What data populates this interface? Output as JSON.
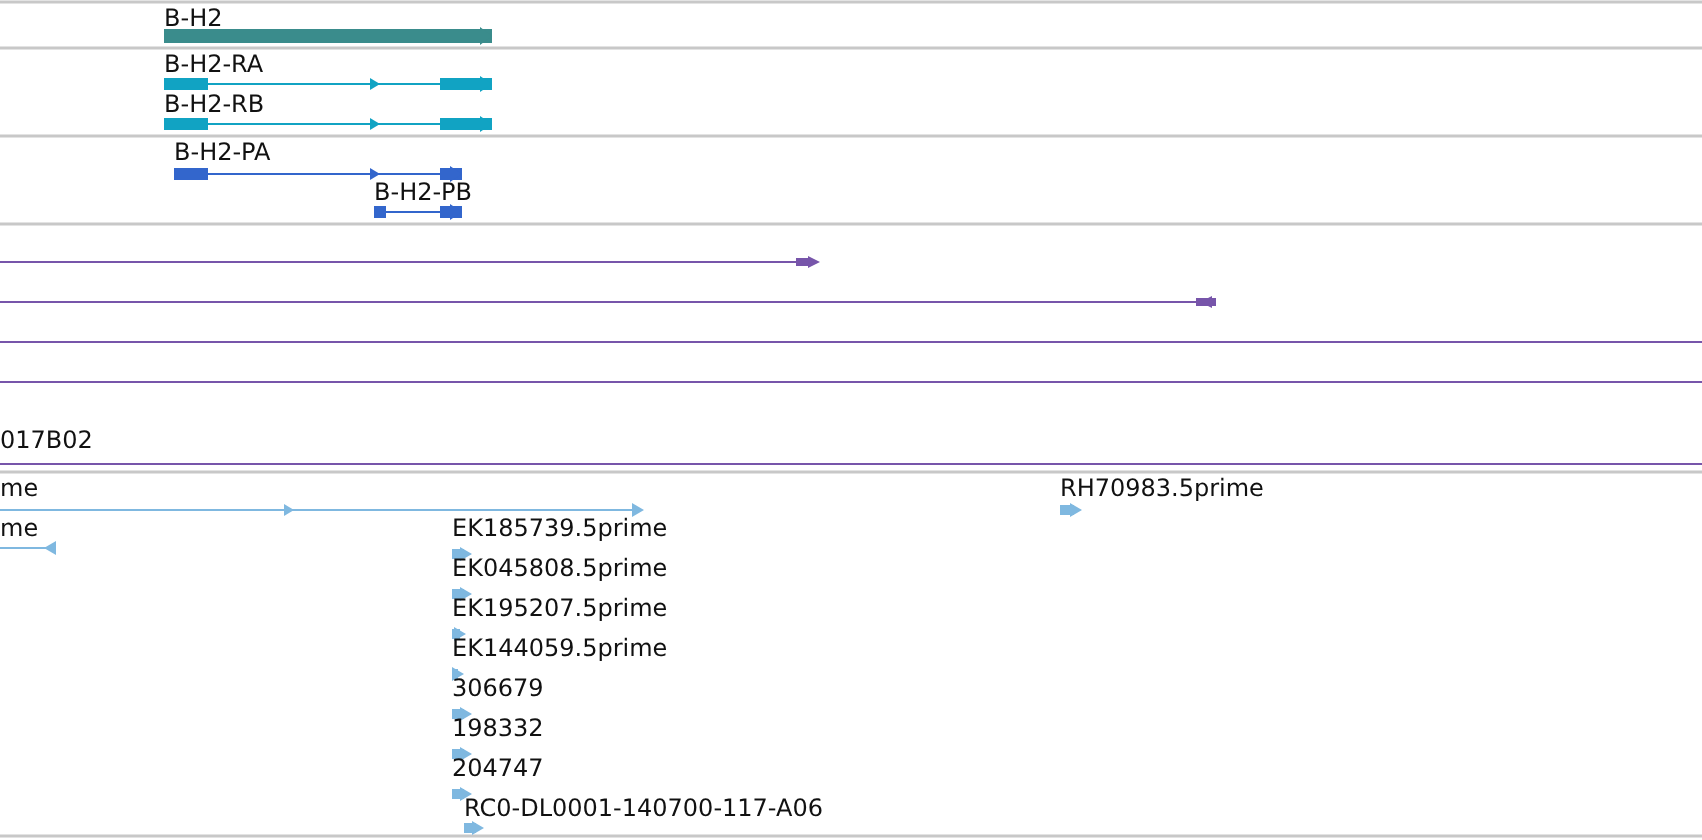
{
  "tracks": [
    {
      "kind": "gene",
      "color": "#3a8c8c",
      "features": [
        {
          "label": "B-H2",
          "reverse": false
        }
      ]
    },
    {
      "kind": "transcript",
      "color": "#11a3c3",
      "features": [
        {
          "label": "B-H2-RA",
          "reverse": false
        },
        {
          "label": "B-H2-RB",
          "reverse": false
        }
      ]
    },
    {
      "kind": "transcript",
      "color": "#3366cc",
      "features": [
        {
          "label": "B-H2-PA",
          "reverse": false
        },
        {
          "label": "B-H2-PB",
          "reverse": false
        }
      ]
    },
    {
      "kind": "match",
      "color": "#7755aa",
      "features": [
        {
          "kind": "arrow",
          "reverse": false
        },
        {
          "kind": "arrow",
          "reverse": true
        },
        {
          "kind": "line"
        },
        {
          "kind": "line"
        },
        {
          "kind": "line",
          "label": "017B02"
        }
      ]
    },
    {
      "kind": "est",
      "color": "#7fb8e0",
      "features": [
        {
          "label": "me",
          "reverse": false
        },
        {
          "label": "me",
          "reverse": true
        },
        {
          "label": "EK185739.5prime",
          "reverse": false
        },
        {
          "label": "EK045808.5prime",
          "reverse": false
        },
        {
          "label": "EK195207.5prime",
          "reverse": false
        },
        {
          "label": "EK144059.5prime",
          "reverse": false
        },
        {
          "label": "306679",
          "reverse": false
        },
        {
          "label": "198332",
          "reverse": false
        },
        {
          "label": "204747",
          "reverse": false
        },
        {
          "label": "RC0-DL0001-140700-117-A06",
          "reverse": false
        },
        {
          "label": "RH70983.5prime",
          "reverse": false
        }
      ]
    }
  ]
}
